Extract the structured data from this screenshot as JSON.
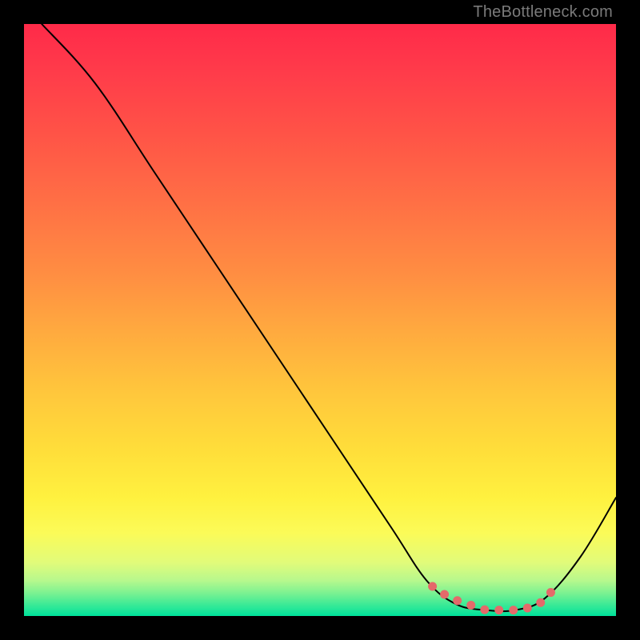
{
  "watermark": "TheBottleneck.com",
  "chart_data": {
    "type": "line",
    "title": "",
    "xlabel": "",
    "ylabel": "",
    "xlim": [
      0,
      100
    ],
    "ylim": [
      0,
      100
    ],
    "grid": false,
    "series": [
      {
        "name": "curve",
        "color": "#000000",
        "points": [
          {
            "x": 3,
            "y": 100
          },
          {
            "x": 12,
            "y": 90
          },
          {
            "x": 22,
            "y": 75
          },
          {
            "x": 32,
            "y": 60
          },
          {
            "x": 42,
            "y": 45
          },
          {
            "x": 52,
            "y": 30
          },
          {
            "x": 62,
            "y": 15
          },
          {
            "x": 68,
            "y": 6
          },
          {
            "x": 73,
            "y": 2
          },
          {
            "x": 78,
            "y": 1
          },
          {
            "x": 83,
            "y": 1
          },
          {
            "x": 88,
            "y": 3
          },
          {
            "x": 94,
            "y": 10
          },
          {
            "x": 100,
            "y": 20
          }
        ]
      },
      {
        "name": "highlight-dots",
        "color": "#e46a6a",
        "points": [
          {
            "x": 69,
            "y": 5
          },
          {
            "x": 72,
            "y": 3
          },
          {
            "x": 75,
            "y": 2
          },
          {
            "x": 78,
            "y": 1
          },
          {
            "x": 81,
            "y": 1
          },
          {
            "x": 84,
            "y": 1
          },
          {
            "x": 87,
            "y": 2
          },
          {
            "x": 90,
            "y": 5
          }
        ]
      }
    ]
  }
}
